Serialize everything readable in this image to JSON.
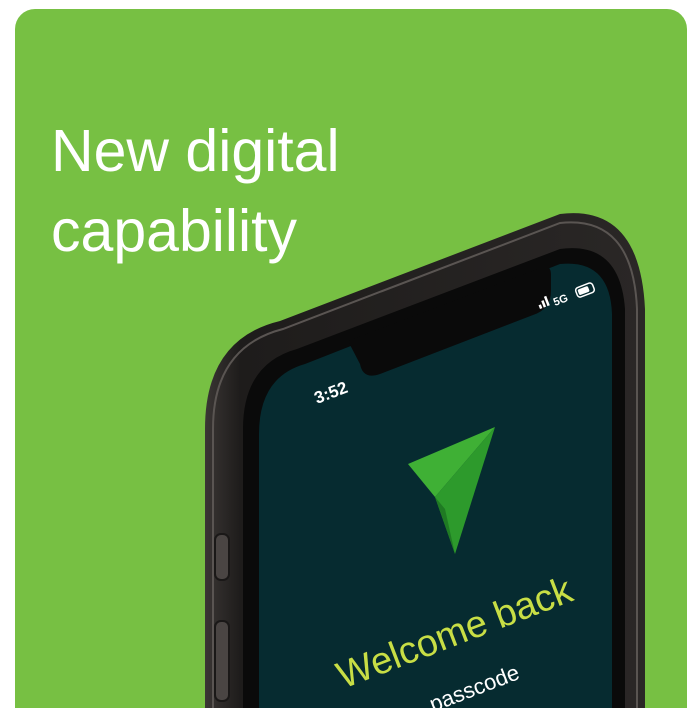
{
  "card": {
    "background": "#77c043",
    "headline_line1": "New digital",
    "headline_line2": "capability"
  },
  "phone": {
    "status_time": "3:52",
    "status_network": "5G",
    "screen_color": "#062b30",
    "logo_icon": "paper-plane-icon",
    "welcome_text": "Welcome back",
    "passcode_text": "passcode"
  }
}
